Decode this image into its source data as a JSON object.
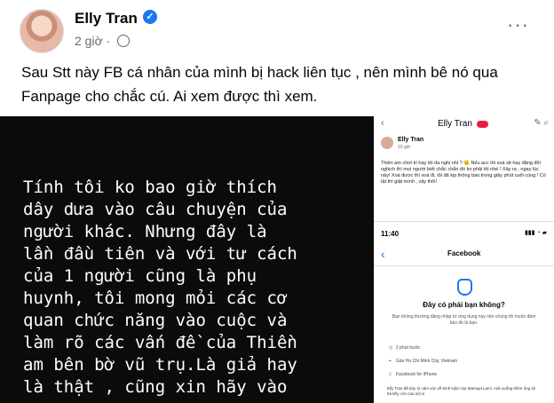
{
  "post": {
    "author": "Elly Tran",
    "time": "2 giờ ·",
    "more": "···",
    "text": "Sau Stt này FB cá nhân của mình bị hack liên tục , nên mình bê nó qua Fanpage cho chắc cú. Ai xem được thì xem."
  },
  "left_image": {
    "text": "Tính tôi ko bao giờ thích\ndây dưa vào câu chuyện của\nngười khác. Nhưng đây là\nlần đầu tiên và với tư cách\ncủa 1 người cũng là phụ\nhuynh, tôi mong mỏi các cơ\nquan chức năng vào cuộc và\nlàm rõ các vấn đề của Thiền\nam bên bờ vũ trụ.Là giả hay\nlà thật , cũng xin hãy vào"
  },
  "right_image": {
    "app_title": "Elly Tran",
    "author": "Elly Tran",
    "time": "10 giờ ·",
    "body": "Thiền am chơi kì hay tôi đa nghi nhỉ ? 😐\nNếu acc tôi xoá stt hay đăng đối nghịch thì mọi người biết chắc chắn đó ko phải tôi nhé ! Xảy ra , ngay lúc này! Xoá được thì xoá đi, tôi đã kịp thông báo trong giây phút cuối cùng ! Có tật thì giật mình , vậy thôi!",
    "phone_time": "11:40",
    "phone_title": "Facebook",
    "dialog_title": "Đây có phải bạn không?",
    "dialog_body": "Bạn không thường đăng nhập từ ứng dụng này nên chúng tôi muốn đảm bảo đó là bạn.",
    "detail_time": "2 phút trước",
    "detail_location": "Gần Ho Chi Minh City, Vietnam",
    "detail_app": "Facebook for iPhone",
    "comment": "Elly Tran đã bày tỏ cảm xúc về bình luận của Marsupi Lami. mái xuống thêm ông tôi bà Elly còn của nội xi"
  }
}
